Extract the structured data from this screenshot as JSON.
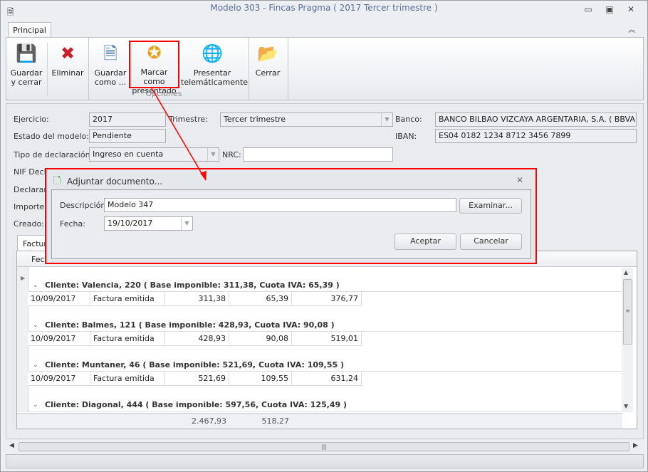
{
  "window": {
    "title": "Modelo 303 - Fincas Pragma ( 2017 Tercer trimestre )"
  },
  "ribbon": {
    "tab": "Principal",
    "group_label": "Opciones",
    "buttons": [
      {
        "l1": "Guardar",
        "l2": "y cerrar"
      },
      {
        "l1": "Eliminar",
        "l2": ""
      },
      {
        "l1": "Guardar",
        "l2": "como ..."
      },
      {
        "l1": "Marcar como",
        "l2": "presentado"
      },
      {
        "l1": "Presentar",
        "l2": "telemáticamente"
      },
      {
        "l1": "Cerrar",
        "l2": ""
      }
    ]
  },
  "form": {
    "ejercicio_label": "Ejercicio:",
    "ejercicio": "2017",
    "trimestre_label": "Trimestre:",
    "trimestre": "Tercer trimestre",
    "banco_label": "Banco:",
    "banco": "BANCO BILBAO VIZCAYA ARGENTARIA, S.A. ( BBVAESMM",
    "estado_label": "Estado del modelo:",
    "estado": "Pendiente",
    "iban_label": "IBAN:",
    "iban": "ES04 0182 1234 8712 3456 7899",
    "tipo_label": "Tipo de declaración:",
    "tipo": "Ingreso en cuenta",
    "nrc_label": "NRC:",
    "nrc": "",
    "nif_label": "NIF Decla",
    "declarante_label": "Declarant",
    "importe_label": "Importe d",
    "creado_label": "Creado:"
  },
  "dialog": {
    "title": "Adjuntar documento...",
    "descripcion_label": "Descripción:",
    "descripcion": "Modelo 347",
    "examinar": "Examinar...",
    "fecha_label": "Fecha:",
    "fecha": "19/10/2017",
    "aceptar": "Aceptar",
    "cancelar": "Cancelar"
  },
  "grid": {
    "tab": "Factur",
    "header_first": "Fech",
    "groups": [
      {
        "title": "Cliente: Valencia, 220 ( Base imponible: 311,38, Cuota IVA: 65,39 )",
        "row": [
          "10/09/2017",
          "Factura emitida",
          "311,38",
          "65,39",
          "376,77"
        ]
      },
      {
        "title": "Cliente: Balmes, 121 ( Base imponible: 428,93, Cuota IVA: 90,08 )",
        "row": [
          "10/09/2017",
          "Factura emitida",
          "428,93",
          "90,08",
          "519,01"
        ]
      },
      {
        "title": "Cliente: Muntaner, 46 ( Base imponible: 521,69, Cuota IVA: 109,55 )",
        "row": [
          "10/09/2017",
          "Factura emitida",
          "521,69",
          "109,55",
          "631,24"
        ]
      },
      {
        "title": "Cliente: Diagonal, 444 ( Base imponible: 597,56, Cuota IVA: 125,49 )"
      }
    ],
    "totals": [
      "2.467,93",
      "518,27"
    ]
  },
  "colors": {
    "highlight": "#ff0000"
  }
}
